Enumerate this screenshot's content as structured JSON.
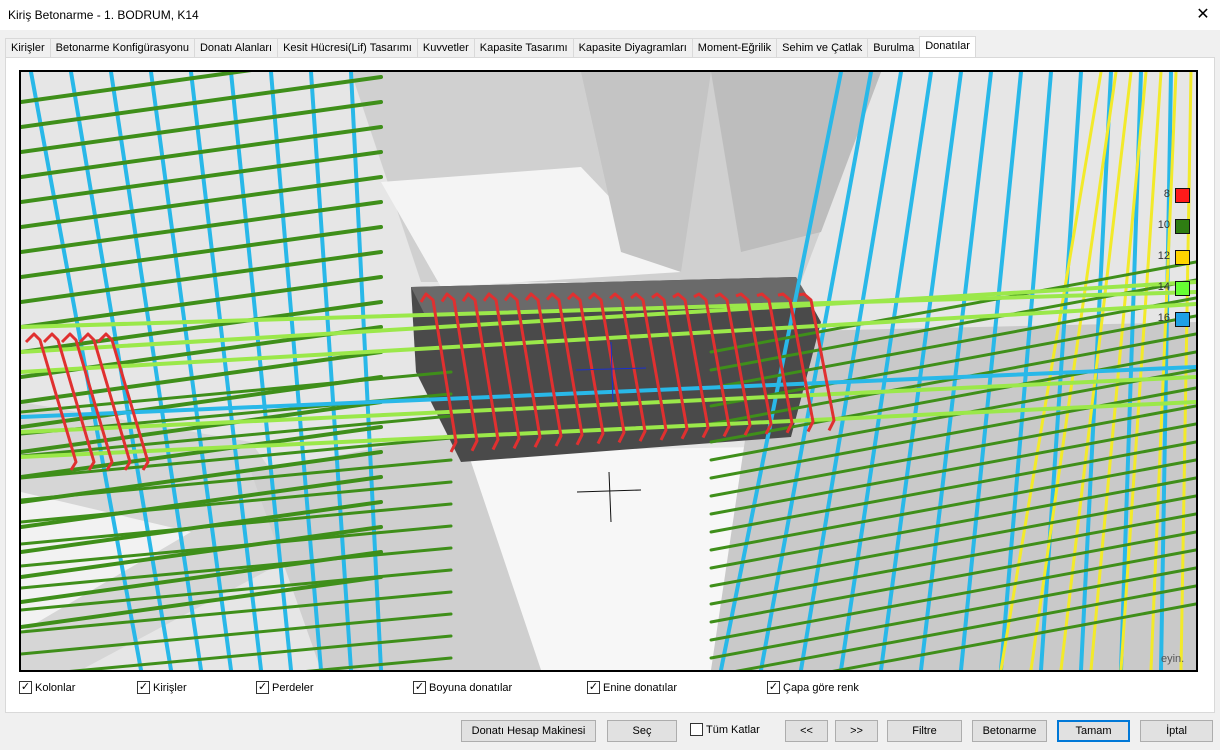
{
  "window": {
    "title": "Kiriş Betonarme - 1. BODRUM, K14",
    "close_glyph": "✕"
  },
  "tabs": [
    {
      "label": "Kirişler"
    },
    {
      "label": "Betonarme Konfigürasyonu"
    },
    {
      "label": "Donatı Alanları"
    },
    {
      "label": "Kesit Hücresi(Lif) Tasarımı"
    },
    {
      "label": "Kuvvetler"
    },
    {
      "label": "Kapasite Tasarımı"
    },
    {
      "label": "Kapasite Diyagramları"
    },
    {
      "label": "Moment-Eğrilik"
    },
    {
      "label": "Sehim ve Çatlak"
    },
    {
      "label": "Burulma"
    },
    {
      "label": "Donatılar",
      "active": true
    }
  ],
  "legend": [
    {
      "label": "8",
      "color": "#ff1a1a"
    },
    {
      "label": "10",
      "color": "#2e7d12"
    },
    {
      "label": "12",
      "color": "#ffd400"
    },
    {
      "label": "14",
      "color": "#66ff33"
    },
    {
      "label": "16",
      "color": "#1ea0e6"
    }
  ],
  "viewport_hint": "eyin.",
  "checkboxes": [
    {
      "label": "Kolonlar",
      "checked": true
    },
    {
      "label": "Kirişler",
      "checked": true
    },
    {
      "label": "Perdeler",
      "checked": true
    },
    {
      "label": "Boyuna donatılar",
      "checked": true
    },
    {
      "label": "Enine donatılar",
      "checked": true
    },
    {
      "label": "Çapa göre renk",
      "checked": true
    }
  ],
  "check_glyph": "✓",
  "tum_katlar": {
    "label": "Tüm Katlar",
    "checked": false
  },
  "buttons": {
    "calculator": "Donatı Hesap Makinesi",
    "select": "Seç",
    "prev": "<<",
    "next": ">>",
    "filter": "Filtre",
    "concrete": "Betonarme",
    "ok": "Tamam",
    "cancel": "İptal"
  },
  "colors": {
    "stirrup": "#e03030",
    "dark_green": "#3f8f1a",
    "light_green": "#9be84a",
    "cyan": "#29b8e8",
    "yellow": "#f2ea2a"
  }
}
